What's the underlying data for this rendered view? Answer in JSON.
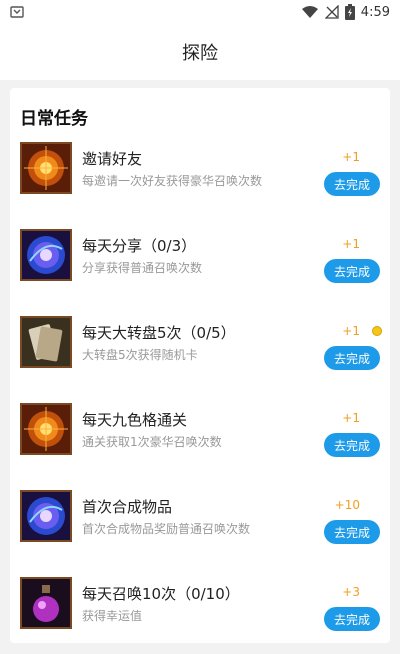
{
  "status_bar": {
    "time": "4:59"
  },
  "header": {
    "title": "探险"
  },
  "section": {
    "title": "日常任务"
  },
  "tasks": [
    {
      "name": "邀请好友",
      "desc": "每邀请一次好友获得豪华召唤次数",
      "reward": "+1",
      "button": "去完成",
      "icon": "orange-orb-icon",
      "coin": false
    },
    {
      "name": "每天分享（0/3）",
      "desc": "分享获得普通召唤次数",
      "reward": "+1",
      "button": "去完成",
      "icon": "blue-orb-icon",
      "coin": false
    },
    {
      "name": "每天大转盘5次（0/5）",
      "desc": "大转盘5次获得随机卡",
      "reward": "+1",
      "button": "去完成",
      "icon": "card-icon",
      "coin": true
    },
    {
      "name": "每天九色格通关",
      "desc": "通关获取1次豪华召唤次数",
      "reward": "+1",
      "button": "去完成",
      "icon": "orange-orb-icon",
      "coin": false
    },
    {
      "name": "首次合成物品",
      "desc": "首次合成物品奖励普通召唤次数",
      "reward": "+10",
      "button": "去完成",
      "icon": "blue-orb-icon",
      "coin": false
    },
    {
      "name": "每天召唤10次（0/10）",
      "desc": "获得幸运值",
      "reward": "+3",
      "button": "去完成",
      "icon": "potion-icon",
      "coin": false
    }
  ],
  "colors": {
    "accent": "#1e9be8",
    "reward": "#f0a020"
  }
}
